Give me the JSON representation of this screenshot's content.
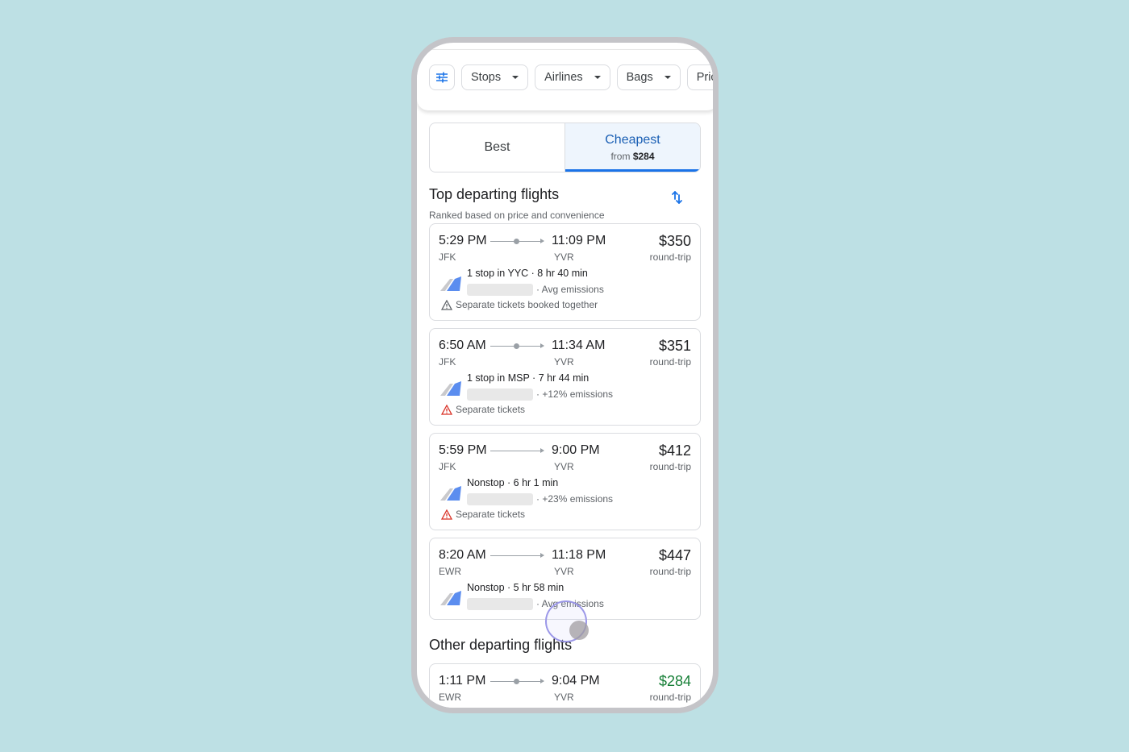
{
  "filters": {
    "icon": "tune-sliders-icon",
    "chips": [
      {
        "label": "Stops"
      },
      {
        "label": "Airlines"
      },
      {
        "label": "Bags"
      },
      {
        "label": "Price"
      }
    ]
  },
  "tabs": {
    "best": {
      "label": "Best"
    },
    "cheapest": {
      "label": "Cheapest",
      "sub_prefix": "from",
      "sub_value": "$284",
      "active": true
    }
  },
  "top_section": {
    "title": "Top departing flights",
    "subtitle": "Ranked based on price and convenience",
    "sort_icon": "swap-vert-icon"
  },
  "top_flights": [
    {
      "depart": "5:29 PM",
      "arrive": "11:09 PM",
      "from": "JFK",
      "to": "YVR",
      "price": "$350",
      "price_note": "round-trip",
      "has_stop": true,
      "summary": "1 stop in YYC · 8 hr 40 min",
      "emissions": "· Avg emissions",
      "warning": "Separate tickets booked together",
      "warning_level": "neutral"
    },
    {
      "depart": "6:50 AM",
      "arrive": "11:34 AM",
      "from": "JFK",
      "to": "YVR",
      "price": "$351",
      "price_note": "round-trip",
      "has_stop": true,
      "summary": "1 stop in MSP · 7 hr 44 min",
      "emissions": "· +12% emissions",
      "warning": "Separate tickets",
      "warning_level": "alert"
    },
    {
      "depart": "5:59 PM",
      "arrive": "9:00 PM",
      "from": "JFK",
      "to": "YVR",
      "price": "$412",
      "price_note": "round-trip",
      "has_stop": false,
      "summary": "Nonstop · 6 hr 1 min",
      "emissions": "· +23% emissions",
      "warning": "Separate tickets",
      "warning_level": "alert"
    },
    {
      "depart": "8:20 AM",
      "arrive": "11:18 PM",
      "from": "EWR",
      "to": "YVR",
      "price": "$447",
      "price_note": "round-trip",
      "has_stop": false,
      "summary": "Nonstop · 5 hr 58 min",
      "emissions": "· Avg emissions",
      "warning": null
    }
  ],
  "other_section": {
    "title": "Other departing flights"
  },
  "other_flights": [
    {
      "depart": "1:11 PM",
      "arrive": "9:04 PM",
      "from": "EWR",
      "to": "YVR",
      "price": "$284",
      "price_note": "round-trip",
      "has_stop": true,
      "price_color": "#188038"
    }
  ],
  "colors": {
    "accent": "#1a73e8",
    "cheap_price": "#188038",
    "warning_red": "#d93025",
    "background": "#bde0e4"
  }
}
